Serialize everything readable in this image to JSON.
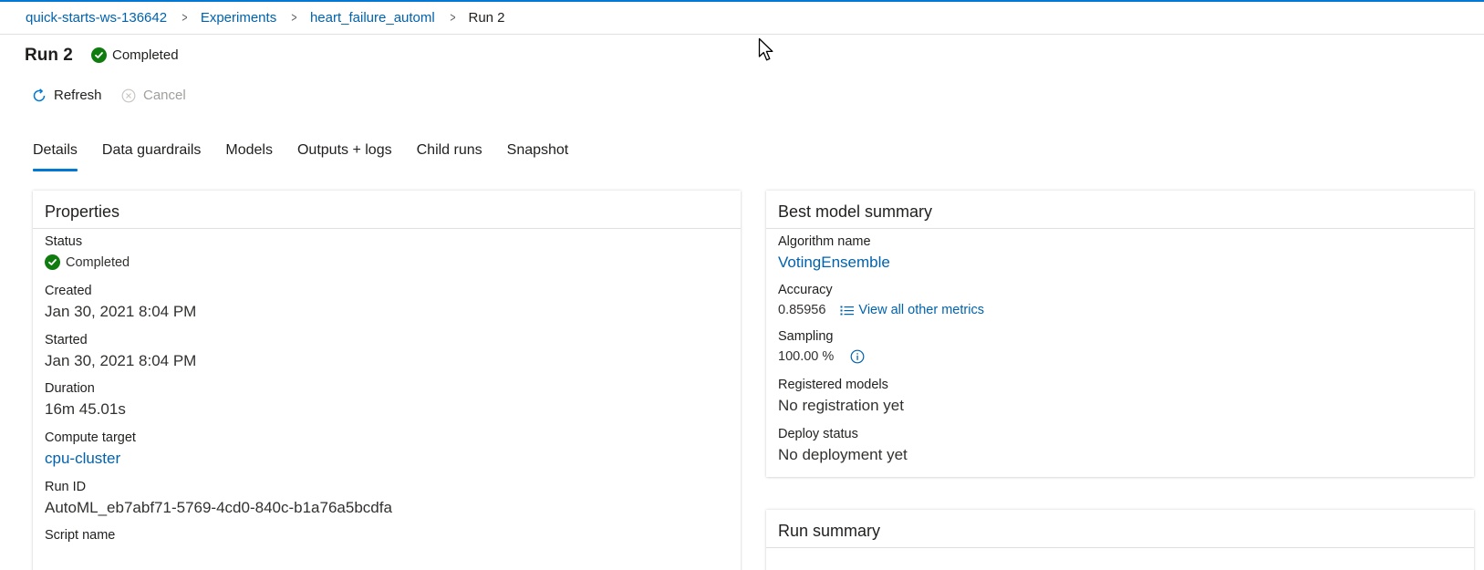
{
  "breadcrumb": {
    "workspace": "quick-starts-ws-136642",
    "experiments": "Experiments",
    "experiment": "heart_failure_automl",
    "current": "Run 2"
  },
  "run": {
    "title": "Run 2",
    "status": "Completed"
  },
  "commands": {
    "refresh": "Refresh",
    "cancel": "Cancel"
  },
  "tabs": [
    "Details",
    "Data guardrails",
    "Models",
    "Outputs + logs",
    "Child runs",
    "Snapshot"
  ],
  "active_tab": "Details",
  "properties": {
    "header": "Properties",
    "status_label": "Status",
    "status_value": "Completed",
    "created_label": "Created",
    "created_value": "Jan 30, 2021 8:04 PM",
    "started_label": "Started",
    "started_value": "Jan 30, 2021 8:04 PM",
    "duration_label": "Duration",
    "duration_value": "16m 45.01s",
    "compute_label": "Compute target",
    "compute_value": "cpu-cluster",
    "runid_label": "Run ID",
    "runid_value": "AutoML_eb7abf71-5769-4cd0-840c-b1a76a5bcdfa",
    "script_label": "Script name"
  },
  "best_model": {
    "header": "Best model summary",
    "algorithm_label": "Algorithm name",
    "algorithm_value": "VotingEnsemble",
    "accuracy_label": "Accuracy",
    "accuracy_value": "0.85956",
    "metrics_link": "View all other metrics",
    "sampling_label": "Sampling",
    "sampling_value": "100.00 %",
    "registered_label": "Registered models",
    "registered_value": "No registration yet",
    "deploy_label": "Deploy status",
    "deploy_value": "No deployment yet"
  },
  "run_summary": {
    "header": "Run summary"
  },
  "colors": {
    "accent": "#0078d4",
    "link": "#0062ad",
    "success": "#107c10",
    "disabled": "#a19f9d"
  },
  "icons": {
    "status": "check-circle-icon",
    "refresh": "refresh-icon",
    "cancel": "cancel-circle-icon",
    "metrics": "list-icon",
    "info": "info-icon",
    "breadcrumb_sep": "chevron-right-icon"
  }
}
